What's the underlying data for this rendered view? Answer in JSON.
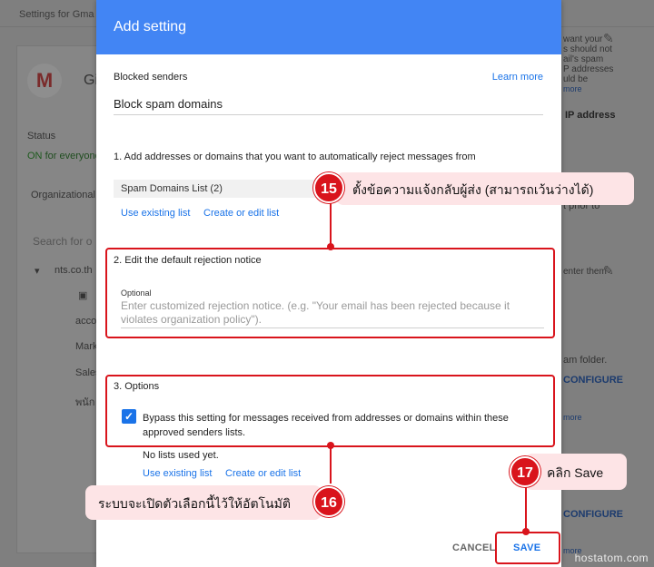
{
  "background": {
    "breadcrumb": "Settings for Gma",
    "app_initial": "M",
    "app_name_fragment": "Gi",
    "status_label": "Status",
    "status_on": "ON",
    "status_rest": "for everyone",
    "org_label": "Organizational",
    "search_placeholder": "Search for o",
    "tree": {
      "root": "nts.co.th",
      "items": [
        "acco",
        "Mark",
        "Sales",
        "พนัก"
      ]
    },
    "right_texts": {
      "t1": "want your",
      "t2": "s should not",
      "t3": "ail's spam",
      "t4": "P addresses",
      "t5": "uld be",
      "more1": "more",
      "ip": "IP address",
      "prior": "t prior to",
      "enter": "enter them",
      "spam_folder": "am folder.",
      "configure1": "CONFIGURE",
      "more2": "more",
      "configure2": "CONFIGURE",
      "more3": "more"
    }
  },
  "dialog": {
    "title": "Add setting",
    "section_label": "Blocked senders",
    "learn_more": "Learn more",
    "setting_name": "Block spam domains",
    "step1": "1. Add addresses or domains that you want to automatically reject messages from",
    "list_chip": "Spam Domains List (2)",
    "use_existing_list": "Use existing list",
    "create_or_edit_list": "Create or edit list",
    "step2": "2. Edit the default rejection notice",
    "optional_label": "Optional",
    "notice_placeholder": "Enter customized rejection notice. (e.g. \"Your email has been rejected because it violates organization policy\").",
    "step3": "3. Options",
    "bypass_label": "Bypass this setting for messages received from addresses or domains within these approved senders lists.",
    "no_lists": "No lists used yet.",
    "use_existing_list_2": "Use existing list",
    "create_or_edit_list_2": "Create or edit list",
    "cancel": "CANCEL",
    "save": "SAVE"
  },
  "callouts": {
    "c15": {
      "number": "15",
      "text": "ตั้งข้อความแจ้งกลับผู้ส่ง (สามารถเว้นว่างได้)"
    },
    "c16": {
      "number": "16",
      "text": "ระบบจะเปิดตัวเลือกนี้ไว้ให้อัตโนมัติ"
    },
    "c17": {
      "number": "17",
      "text": "คลิก Save"
    }
  },
  "watermark": "hostatom.com",
  "colors": {
    "header_blue": "#4285f4",
    "link_blue": "#1a73e8",
    "annotation_red": "#d9141c",
    "callout_pink": "#fde4e6"
  }
}
